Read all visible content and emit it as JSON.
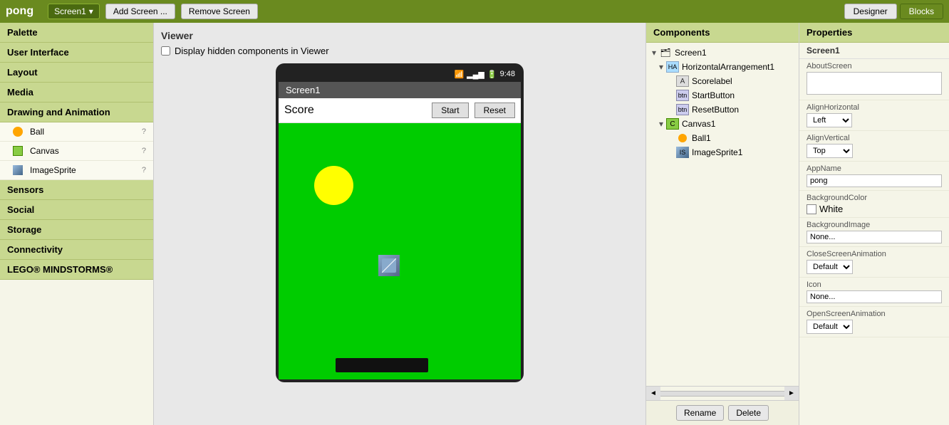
{
  "app": {
    "title": "pong"
  },
  "topbar": {
    "screen_dropdown": "Screen1",
    "add_screen_label": "Add Screen ...",
    "remove_screen_label": "Remove Screen",
    "designer_label": "Designer",
    "blocks_label": "Blocks"
  },
  "palette": {
    "title": "Palette",
    "sections": [
      {
        "id": "user-interface",
        "label": "User Interface"
      },
      {
        "id": "layout",
        "label": "Layout"
      },
      {
        "id": "media",
        "label": "Media"
      },
      {
        "id": "drawing-animation",
        "label": "Drawing and Animation",
        "items": [
          {
            "label": "Ball",
            "icon": "ball"
          },
          {
            "label": "Canvas",
            "icon": "canvas"
          },
          {
            "label": "ImageSprite",
            "icon": "sprite"
          }
        ]
      },
      {
        "id": "sensors",
        "label": "Sensors"
      },
      {
        "id": "social",
        "label": "Social"
      },
      {
        "id": "storage",
        "label": "Storage"
      },
      {
        "id": "connectivity",
        "label": "Connectivity"
      },
      {
        "id": "lego",
        "label": "LEGO® MINDSTORMS®"
      }
    ]
  },
  "viewer": {
    "title": "Viewer",
    "checkbox_label": "Display hidden components in Viewer",
    "phone": {
      "status_time": "9:48",
      "screen_name": "Screen1",
      "score_label": "Score",
      "start_btn": "Start",
      "reset_btn": "Reset"
    }
  },
  "components": {
    "title": "Components",
    "tree": [
      {
        "id": "screen1",
        "label": "Screen1",
        "level": 0,
        "indent": 0,
        "toggle": "▾",
        "icon": "screen"
      },
      {
        "id": "ha1",
        "label": "HorizontalArrangement1",
        "level": 1,
        "indent": 1,
        "toggle": "▾",
        "icon": "ha"
      },
      {
        "id": "scorelabel",
        "label": "Scorelabel",
        "level": 2,
        "indent": 2,
        "toggle": "",
        "icon": "label"
      },
      {
        "id": "startbutton",
        "label": "StartButton",
        "level": 2,
        "indent": 2,
        "toggle": "",
        "icon": "button"
      },
      {
        "id": "resetbutton",
        "label": "ResetButton",
        "level": 2,
        "indent": 2,
        "toggle": "",
        "icon": "button"
      },
      {
        "id": "canvas1",
        "label": "Canvas1",
        "level": 1,
        "indent": 1,
        "toggle": "▾",
        "icon": "canvas"
      },
      {
        "id": "ball1",
        "label": "Ball1",
        "level": 2,
        "indent": 2,
        "toggle": "",
        "icon": "ball"
      },
      {
        "id": "imagesprite1",
        "label": "ImageSprite1",
        "level": 2,
        "indent": 2,
        "toggle": "",
        "icon": "sprite"
      }
    ],
    "rename_btn": "Rename",
    "delete_btn": "Delete"
  },
  "properties": {
    "title": "Properties",
    "screen_name": "Screen1",
    "props": [
      {
        "id": "about-screen",
        "label": "AboutScreen",
        "type": "textarea",
        "value": ""
      },
      {
        "id": "align-horizontal",
        "label": "AlignHorizontal",
        "type": "select",
        "value": "Left"
      },
      {
        "id": "align-vertical",
        "label": "AlignVertical",
        "type": "select",
        "value": "Top"
      },
      {
        "id": "app-name",
        "label": "AppName",
        "type": "input",
        "value": "pong"
      },
      {
        "id": "background-color",
        "label": "BackgroundColor",
        "type": "color",
        "value": "White",
        "color": "#ffffff"
      },
      {
        "id": "background-image",
        "label": "BackgroundImage",
        "type": "input",
        "value": "None..."
      },
      {
        "id": "close-screen-animation",
        "label": "CloseScreenAnimation",
        "type": "select",
        "value": "Default"
      },
      {
        "id": "icon",
        "label": "Icon",
        "type": "input",
        "value": "None..."
      },
      {
        "id": "open-screen-animation",
        "label": "OpenScreenAnimation",
        "type": "select",
        "value": "Default"
      }
    ]
  }
}
